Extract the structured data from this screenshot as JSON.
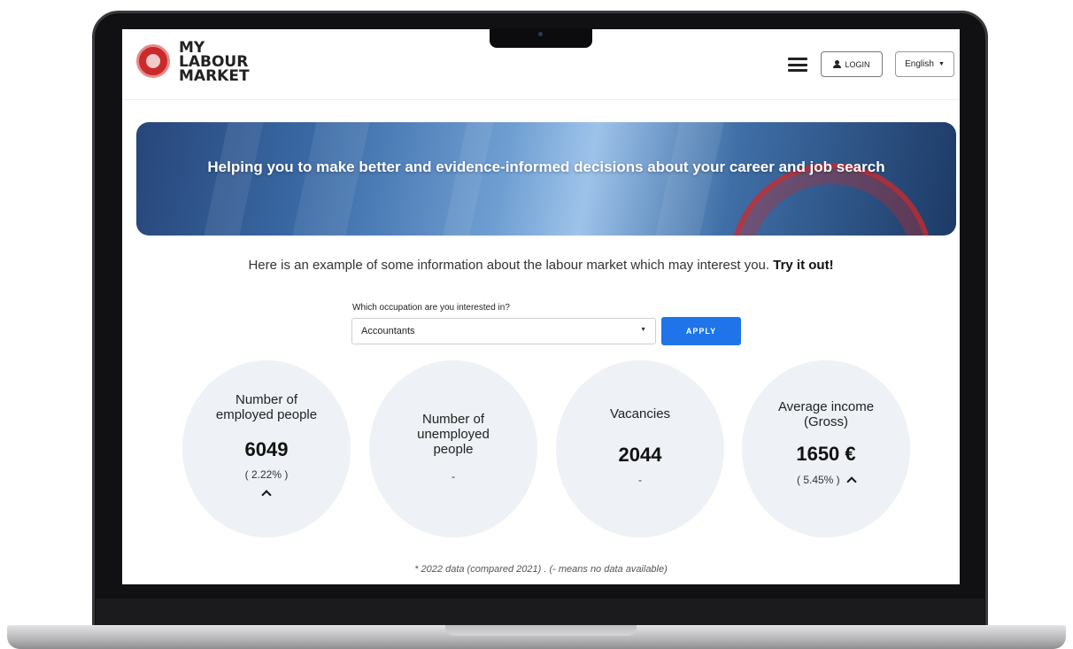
{
  "header": {
    "logo_lines": [
      "MY",
      "LABOUR",
      "MARKET"
    ],
    "login_label": "LOGIN",
    "language": "English"
  },
  "hero": {
    "title": "Helping you to make better and evidence-informed decisions about your career and job search"
  },
  "intro": {
    "text": "Here is an example of some information about the labour market which may interest you.",
    "cta": "Try it out!"
  },
  "occupation": {
    "label": "Which occupation are you interested in?",
    "selected": "Accountants",
    "apply_label": "APPLY"
  },
  "stats": [
    {
      "title_lines": [
        "Number of",
        "employed people"
      ],
      "value": "6049",
      "change": "( 2.22% )",
      "trend": "up"
    },
    {
      "title_lines": [
        "Number of",
        "unemployed",
        "people"
      ],
      "value": "",
      "change": "-",
      "trend": ""
    },
    {
      "title_lines": [
        "Vacancies"
      ],
      "value": "2044",
      "change": "-",
      "trend": ""
    },
    {
      "title_lines": [
        "Average income",
        "(Gross)"
      ],
      "value": "1650 €",
      "change": "( 5.45% )",
      "trend": "up"
    }
  ],
  "footnote": "* 2022 data (compared 2021) . (- means no data available)",
  "colors": {
    "primary": "#1e74e8",
    "stat_background": "#eef1f6",
    "brand_red": "#c92a2a"
  }
}
